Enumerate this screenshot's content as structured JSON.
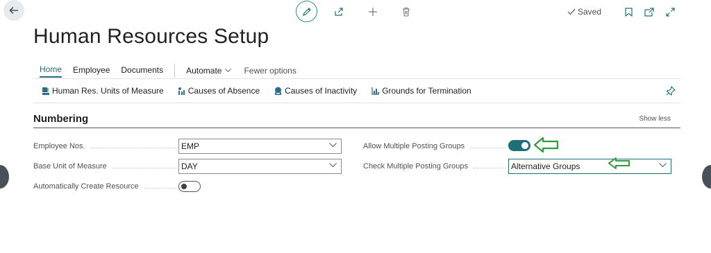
{
  "header": {
    "saved_label": "Saved"
  },
  "page": {
    "title": "Human Resources Setup"
  },
  "action_bar": {
    "tabs": [
      {
        "label": "Home",
        "active": true
      },
      {
        "label": "Employee"
      },
      {
        "label": "Documents"
      }
    ],
    "automate_label": "Automate",
    "fewer_options_label": "Fewer options"
  },
  "promoted_actions": [
    {
      "label": "Human Res. Units of Measure",
      "icon": "units-icon"
    },
    {
      "label": "Causes of Absence",
      "icon": "absence-icon"
    },
    {
      "label": "Causes of Inactivity",
      "icon": "inactivity-icon"
    },
    {
      "label": "Grounds for Termination",
      "icon": "termination-icon"
    }
  ],
  "numbering": {
    "title": "Numbering",
    "show_less_label": "Show less",
    "fields": {
      "employee_nos": {
        "label": "Employee Nos.",
        "value": "EMP"
      },
      "base_unit": {
        "label": "Base Unit of Measure",
        "value": "DAY"
      },
      "auto_create_resource": {
        "label": "Automatically Create Resource",
        "on": false
      },
      "allow_multiple_posting": {
        "label": "Allow Multiple Posting Groups",
        "on": true
      },
      "check_multiple_posting": {
        "label": "Check Multiple Posting Groups",
        "value": "Alternative Groups"
      }
    }
  },
  "colors": {
    "accent": "#1f6f78",
    "annotation_arrow": "#2e9b3a"
  }
}
